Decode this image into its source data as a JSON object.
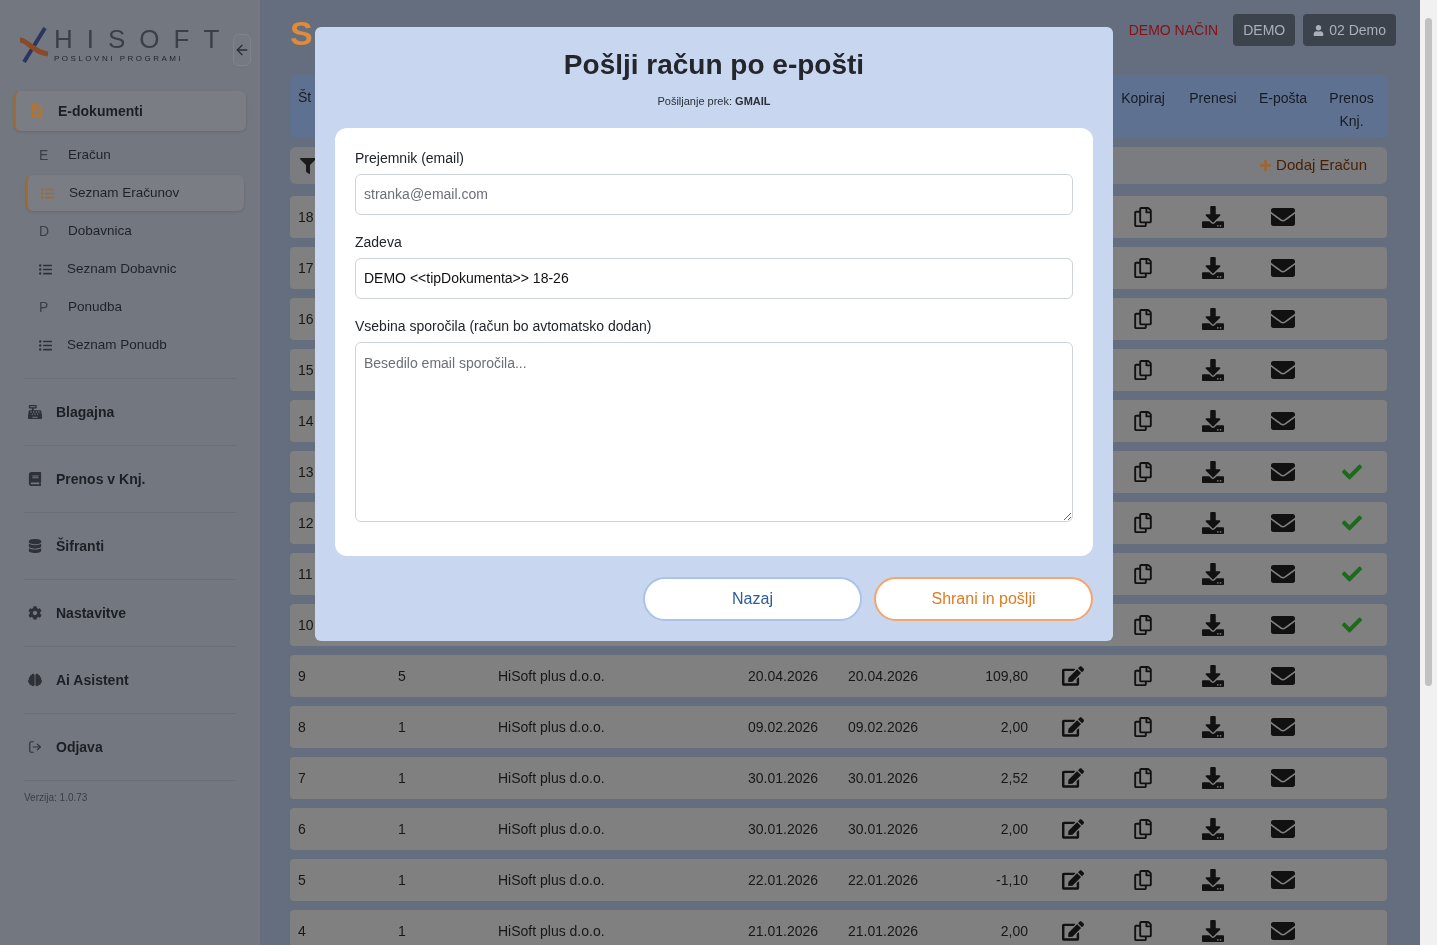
{
  "sidebar": {
    "logo": {
      "name": "HISOFT",
      "tagline": "POSLOVNI PROGRAMI"
    },
    "groups": [
      {
        "label": "E-dokumenti",
        "selected": true,
        "expanded": true,
        "children": [
          {
            "kind": "letter",
            "icon_text": "E",
            "label": "Eračun",
            "selected": false
          },
          {
            "kind": "list",
            "label": "Seznam Eračunov",
            "selected": true
          },
          {
            "kind": "letter",
            "icon_text": "D",
            "label": "Dobavnica",
            "selected": false
          },
          {
            "kind": "list",
            "label": "Seznam Dobavnic",
            "selected": false
          },
          {
            "kind": "letter",
            "icon_text": "P",
            "label": "Ponudba",
            "selected": false
          },
          {
            "kind": "list",
            "label": "Seznam Ponudb",
            "selected": false
          }
        ]
      },
      {
        "label": "Blagajna",
        "selected": false
      },
      {
        "label": "Prenos v Knj.",
        "selected": false
      },
      {
        "label": "Šifranti",
        "selected": false
      },
      {
        "label": "Nastavitve",
        "selected": false
      },
      {
        "label": "Ai Asistent",
        "selected": false
      },
      {
        "label": "Odjava",
        "selected": false
      }
    ],
    "version": "Verzija: 1.0.73"
  },
  "page": {
    "title": "S",
    "mode_label": "DEMO NAČIN",
    "demo_button": "DEMO",
    "user_button": "02 Demo"
  },
  "table": {
    "first_column": "Št",
    "action_columns": [
      "Kopiraj",
      "Prenesi",
      "E-pošta",
      "Prenos Knj."
    ],
    "add_button": "Dodaj Eračun",
    "rows": [
      {
        "number": "18",
        "transferred": false
      },
      {
        "number": "17",
        "transferred": false
      },
      {
        "number": "16",
        "transferred": false
      },
      {
        "number": "15",
        "transferred": false
      },
      {
        "number": "14",
        "transferred": false
      },
      {
        "number": "13",
        "transferred": true
      },
      {
        "number": "12",
        "transferred": true
      },
      {
        "number": "11",
        "transferred": true
      },
      {
        "number": "10",
        "transferred": true
      },
      {
        "number": "9",
        "series": "5",
        "customer": "HiSoft plus d.o.o.",
        "issued": "20.04.2026",
        "due": "20.04.2026",
        "amount": "109,80",
        "transferred": false
      },
      {
        "number": "8",
        "series": "1",
        "customer": "HiSoft plus d.o.o.",
        "issued": "09.02.2026",
        "due": "09.02.2026",
        "amount": "2,00",
        "transferred": false
      },
      {
        "number": "7",
        "series": "1",
        "customer": "HiSoft plus d.o.o.",
        "issued": "30.01.2026",
        "due": "30.01.2026",
        "amount": "2,52",
        "transferred": false
      },
      {
        "number": "6",
        "series": "1",
        "customer": "HiSoft plus d.o.o.",
        "issued": "30.01.2026",
        "due": "30.01.2026",
        "amount": "2,00",
        "transferred": false
      },
      {
        "number": "5",
        "series": "1",
        "customer": "HiSoft plus d.o.o.",
        "issued": "22.01.2026",
        "due": "22.01.2026",
        "amount": "-1,10",
        "transferred": false
      },
      {
        "number": "4",
        "series": "1",
        "customer": "HiSoft plus d.o.o.",
        "issued": "21.01.2026",
        "due": "21.01.2026",
        "amount": "2,00",
        "transferred": false
      }
    ]
  },
  "dialog": {
    "title": "Pošlji račun po e-pošti",
    "subtitle": "Pošiljanje prek: **GMAIL**",
    "fields": [
      {
        "kind": "input",
        "label": "Prejemnik (email)",
        "placeholder": "stranka@email.com"
      },
      {
        "kind": "input",
        "label": "Zadeva",
        "value": "DEMO <<tipDokumenta>> 18-26"
      },
      {
        "kind": "textarea",
        "label": "Vsebina sporočila (račun bo avtomatsko dodan)",
        "placeholder": "Besedilo email sporočila..."
      }
    ],
    "buttons": [
      {
        "kind": "secondary",
        "label": "Nazaj"
      },
      {
        "kind": "primary",
        "label": "Shrani in pošlji"
      }
    ]
  }
}
